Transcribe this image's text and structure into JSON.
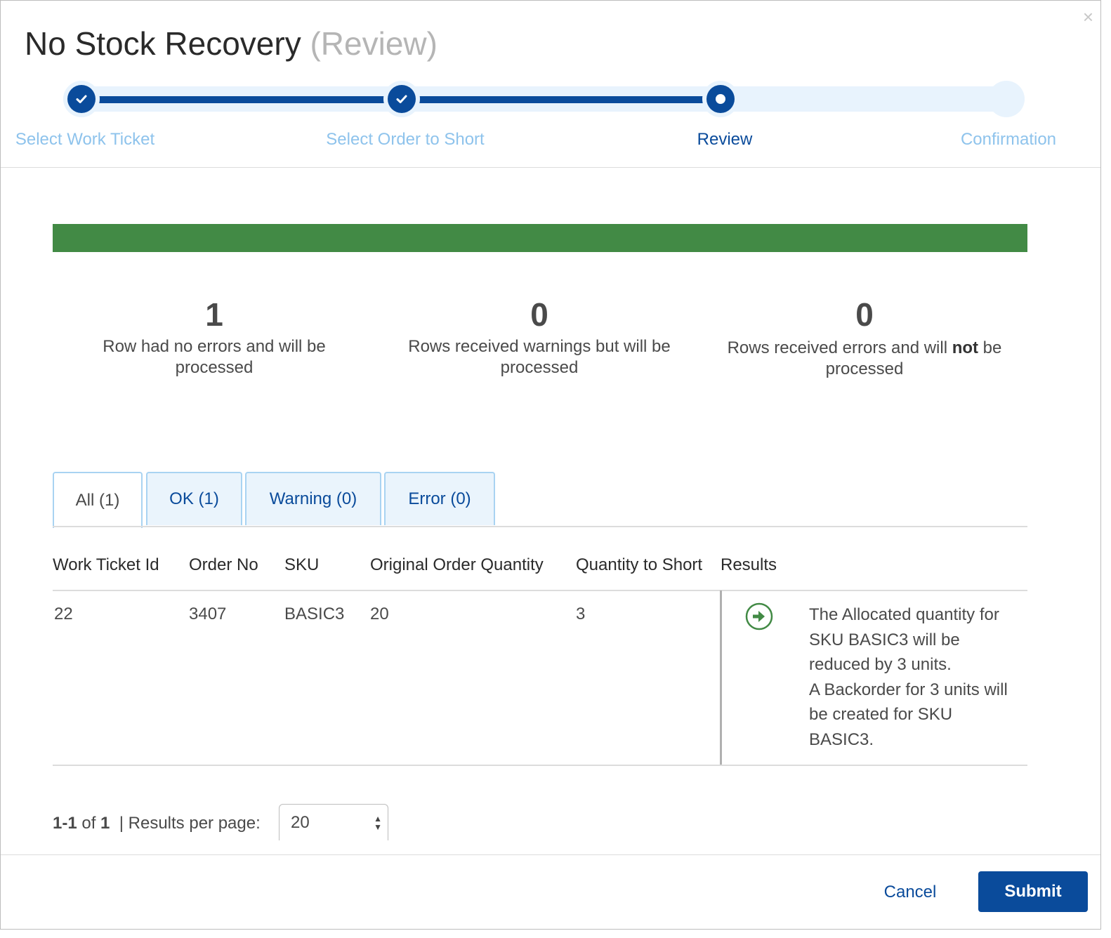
{
  "dialog": {
    "close_glyph": "×",
    "title": "No Stock Recovery",
    "title_sub": "(Review)"
  },
  "stepper": {
    "steps": [
      {
        "label": "Select Work Ticket",
        "state": "complete"
      },
      {
        "label": "Select Order to Short",
        "state": "complete"
      },
      {
        "label": "Review",
        "state": "active"
      },
      {
        "label": "Confirmation",
        "state": "pending"
      }
    ]
  },
  "progress": {
    "fraction": 1.0,
    "color": "#428a45"
  },
  "stats": [
    {
      "count": "1",
      "desc": "Row had no errors and will be processed"
    },
    {
      "count": "0",
      "desc": "Rows received warnings but will be processed"
    },
    {
      "count": "0",
      "desc_pre": "Rows received errors and will ",
      "desc_bold": "not",
      "desc_post": " be processed"
    }
  ],
  "tabs": [
    {
      "label": "All (1)",
      "active": true
    },
    {
      "label": "OK (1)",
      "active": false
    },
    {
      "label": "Warning (0)",
      "active": false
    },
    {
      "label": "Error (0)",
      "active": false
    }
  ],
  "table": {
    "columns": [
      "Work Ticket Id",
      "Order No",
      "SKU",
      "Original Order Quantity",
      "Quantity to Short",
      "Results"
    ],
    "rows": [
      {
        "work_ticket_id": "22",
        "order_no": "3407",
        "sku": "BASIC3",
        "original_order_quantity": "20",
        "quantity_to_short": "3",
        "result_icon": "arrow-right-circle-icon",
        "result_line1": "The Allocated quantity for SKU BASIC3 will be reduced by 3 units.",
        "result_line2": "A Backorder for 3 units will be created for SKU BASIC3."
      }
    ]
  },
  "pagination": {
    "range": "1-1",
    "of": "of",
    "total": "1",
    "separator": "|",
    "per_page_label": "Results per page:",
    "per_page_value": "20"
  },
  "footer": {
    "cancel_label": "Cancel",
    "submit_label": "Submit"
  },
  "colors": {
    "primary": "#0a4b9b",
    "success": "#428a45",
    "step_inactive": "#8ec3ec",
    "tab_bg": "#eaf4fc"
  }
}
